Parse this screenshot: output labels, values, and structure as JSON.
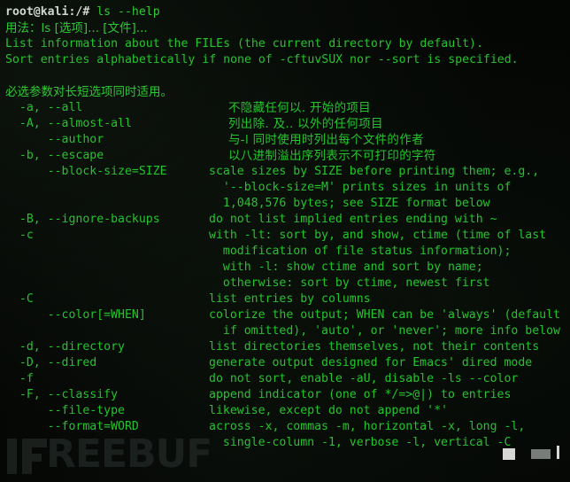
{
  "terminal": {
    "prompt": "root@kali:/# ",
    "command": "ls --help",
    "usage_line": "用法：ls [选项]... [文件]...",
    "intro_lines": [
      "List information about the FILEs (the current directory by default).",
      "Sort entries alphabetically if none of -cftuvSUX nor --sort is specified."
    ],
    "mandatory_note": "必选参数对长短选项同时适用。",
    "options": [
      {
        "opt": "  -a, --all",
        "desc": "不隐藏任何以. 开始的项目",
        "cjk": true
      },
      {
        "opt": "  -A, --almost-all",
        "desc": "列出除. 及.. 以外的任何项目",
        "cjk": true
      },
      {
        "opt": "      --author",
        "desc": "与-l 同时使用时列出每个文件的作者",
        "cjk": true
      },
      {
        "opt": "  -b, --escape",
        "desc": "以八进制溢出序列表示不可打印的字符",
        "cjk": true
      },
      {
        "opt": "      --block-size=SIZE",
        "desc": "scale sizes by SIZE before printing them; e.g.,",
        "cjk": false
      },
      {
        "opt": "",
        "desc": "  '--block-size=M' prints sizes in units of",
        "cjk": false
      },
      {
        "opt": "",
        "desc": "  1,048,576 bytes; see SIZE format below",
        "cjk": false
      },
      {
        "opt": "  -B, --ignore-backups",
        "desc": "do not list implied entries ending with ~",
        "cjk": false
      },
      {
        "opt": "  -c",
        "desc": "with -lt: sort by, and show, ctime (time of last",
        "cjk": false
      },
      {
        "opt": "",
        "desc": "  modification of file status information);",
        "cjk": false
      },
      {
        "opt": "",
        "desc": "  with -l: show ctime and sort by name;",
        "cjk": false
      },
      {
        "opt": "",
        "desc": "  otherwise: sort by ctime, newest first",
        "cjk": false
      },
      {
        "opt": "  -C",
        "desc": "list entries by columns",
        "cjk": false
      },
      {
        "opt": "      --color[=WHEN]",
        "desc": "colorize the output; WHEN can be 'always' (default",
        "cjk": false
      },
      {
        "opt": "",
        "desc": "  if omitted), 'auto', or 'never'; more info below",
        "cjk": false
      },
      {
        "opt": "  -d, --directory",
        "desc": "list directories themselves, not their contents",
        "cjk": false
      },
      {
        "opt": "  -D, --dired",
        "desc": "generate output designed for Emacs' dired mode",
        "cjk": false
      },
      {
        "opt": "  -f",
        "desc": "do not sort, enable -aU, disable -ls --color",
        "cjk": false
      },
      {
        "opt": "  -F, --classify",
        "desc": "append indicator (one of */=>@|) to entries",
        "cjk": false
      },
      {
        "opt": "      --file-type",
        "desc": "likewise, except do not append '*'",
        "cjk": false
      },
      {
        "opt": "      --format=WORD",
        "desc": "across -x, commas -m, horizontal -x, long -l,",
        "cjk": false
      },
      {
        "opt": "",
        "desc": "  single-column -1, verbose -l, vertical -C",
        "cjk": false
      }
    ]
  },
  "watermark": {
    "text": "REEBUF",
    "name": "FREEBUF"
  },
  "colors": {
    "background": "#050505",
    "text_green": "#24c42b",
    "prompt_gray": "#cfd6cf",
    "watermark": "#2b3330"
  }
}
